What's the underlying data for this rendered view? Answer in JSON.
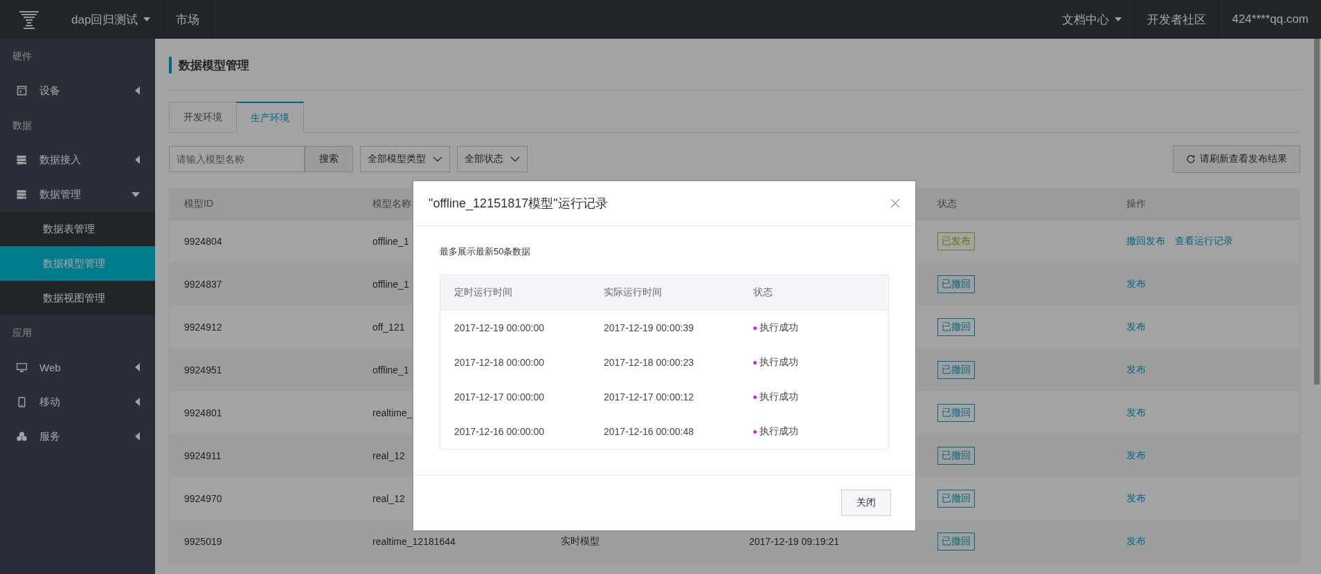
{
  "top_bar": {
    "left": [
      {
        "label": "dap回归测试",
        "dropdown": true
      },
      {
        "label": "市场",
        "dropdown": false
      }
    ],
    "right": [
      {
        "label": "文档中心",
        "dropdown": true
      },
      {
        "label": "开发者社区",
        "dropdown": false
      },
      {
        "label": "424****qq.com",
        "dropdown": false
      }
    ]
  },
  "sidebar": {
    "sections": [
      {
        "title": "硬件",
        "items": [
          {
            "label": "设备",
            "expanded": false
          }
        ]
      },
      {
        "title": "数据",
        "items": [
          {
            "label": "数据接入",
            "expanded": false
          },
          {
            "label": "数据管理",
            "expanded": true,
            "children": [
              {
                "label": "数据表管理",
                "selected": false
              },
              {
                "label": "数据模型管理",
                "selected": true
              },
              {
                "label": "数据视图管理",
                "selected": false
              }
            ]
          }
        ]
      },
      {
        "title": "应用",
        "items": [
          {
            "label": "Web",
            "expanded": false
          },
          {
            "label": "移动",
            "expanded": false
          },
          {
            "label": "服务",
            "expanded": false
          }
        ]
      }
    ]
  },
  "page_title": "数据模型管理",
  "tabs": [
    {
      "label": "开发环境",
      "selected": false
    },
    {
      "label": "生产环境",
      "selected": true
    }
  ],
  "filters": {
    "search": {
      "placeholder": "请输入模型名称",
      "button": "搜索"
    },
    "selects": [
      "全部模型类型",
      "全部状态"
    ],
    "refresh_button": "请刷新查看发布结果"
  },
  "table": {
    "columns": [
      "模型ID",
      "模型名称",
      null,
      null,
      "状态",
      "操作"
    ],
    "rows": [
      {
        "id": "9924804",
        "name": "offline_1",
        "status": {
          "kind": "published",
          "label": "已发布"
        },
        "actions": [
          "撤回发布",
          "查看运行记录"
        ]
      },
      {
        "id": "9924837",
        "name": "offline_1",
        "status": {
          "kind": "revoked",
          "label": "已撤回"
        },
        "actions": [
          "发布"
        ]
      },
      {
        "id": "9924912",
        "name": "off_121",
        "status": {
          "kind": "revoked",
          "label": "已撤回"
        },
        "actions": [
          "发布"
        ]
      },
      {
        "id": "9924951",
        "name": "offline_1",
        "status": {
          "kind": "revoked",
          "label": "已撤回"
        },
        "actions": [
          "发布"
        ]
      },
      {
        "id": "9924801",
        "name": "realtime_",
        "status": {
          "kind": "revoked",
          "label": "已撤回"
        },
        "actions": [
          "发布"
        ]
      },
      {
        "id": "9924911",
        "name": "real_12",
        "status": {
          "kind": "revoked",
          "label": "已撤回"
        },
        "actions": [
          "发布"
        ]
      },
      {
        "id": "9924970",
        "name": "real_12",
        "status": {
          "kind": "revoked",
          "label": "已撤回"
        },
        "actions": [
          "发布"
        ]
      },
      {
        "id": "9925019",
        "name": "realtime_12181644",
        "column_3": "实时模型",
        "column_4": "2017-12-19 09:19:21",
        "status": {
          "kind": "revoked",
          "label": "已撤回"
        },
        "actions": [
          "发布"
        ]
      }
    ]
  },
  "modal": {
    "title": "\"offline_12151817模型\"运行记录",
    "note": "最多展示最新50条数据",
    "columns": [
      "定时运行时间",
      "实际运行时间",
      "状态"
    ],
    "rows": [
      {
        "scheduled": "2017-12-19 00:00:00",
        "actual": "2017-12-19 00:00:39",
        "status": "执行成功",
        "color": "#cc22ee"
      },
      {
        "scheduled": "2017-12-18 00:00:00",
        "actual": "2017-12-18 00:00:23",
        "status": "执行成功",
        "color": "#cc22ee"
      },
      {
        "scheduled": "2017-12-17 00:00:00",
        "actual": "2017-12-17 00:00:12",
        "status": "执行成功",
        "color": "#cc22ee"
      },
      {
        "scheduled": "2017-12-16 00:00:00",
        "actual": "2017-12-16 00:00:48",
        "status": "执行成功",
        "color": "#cc22ee"
      }
    ],
    "button": "关闭"
  }
}
